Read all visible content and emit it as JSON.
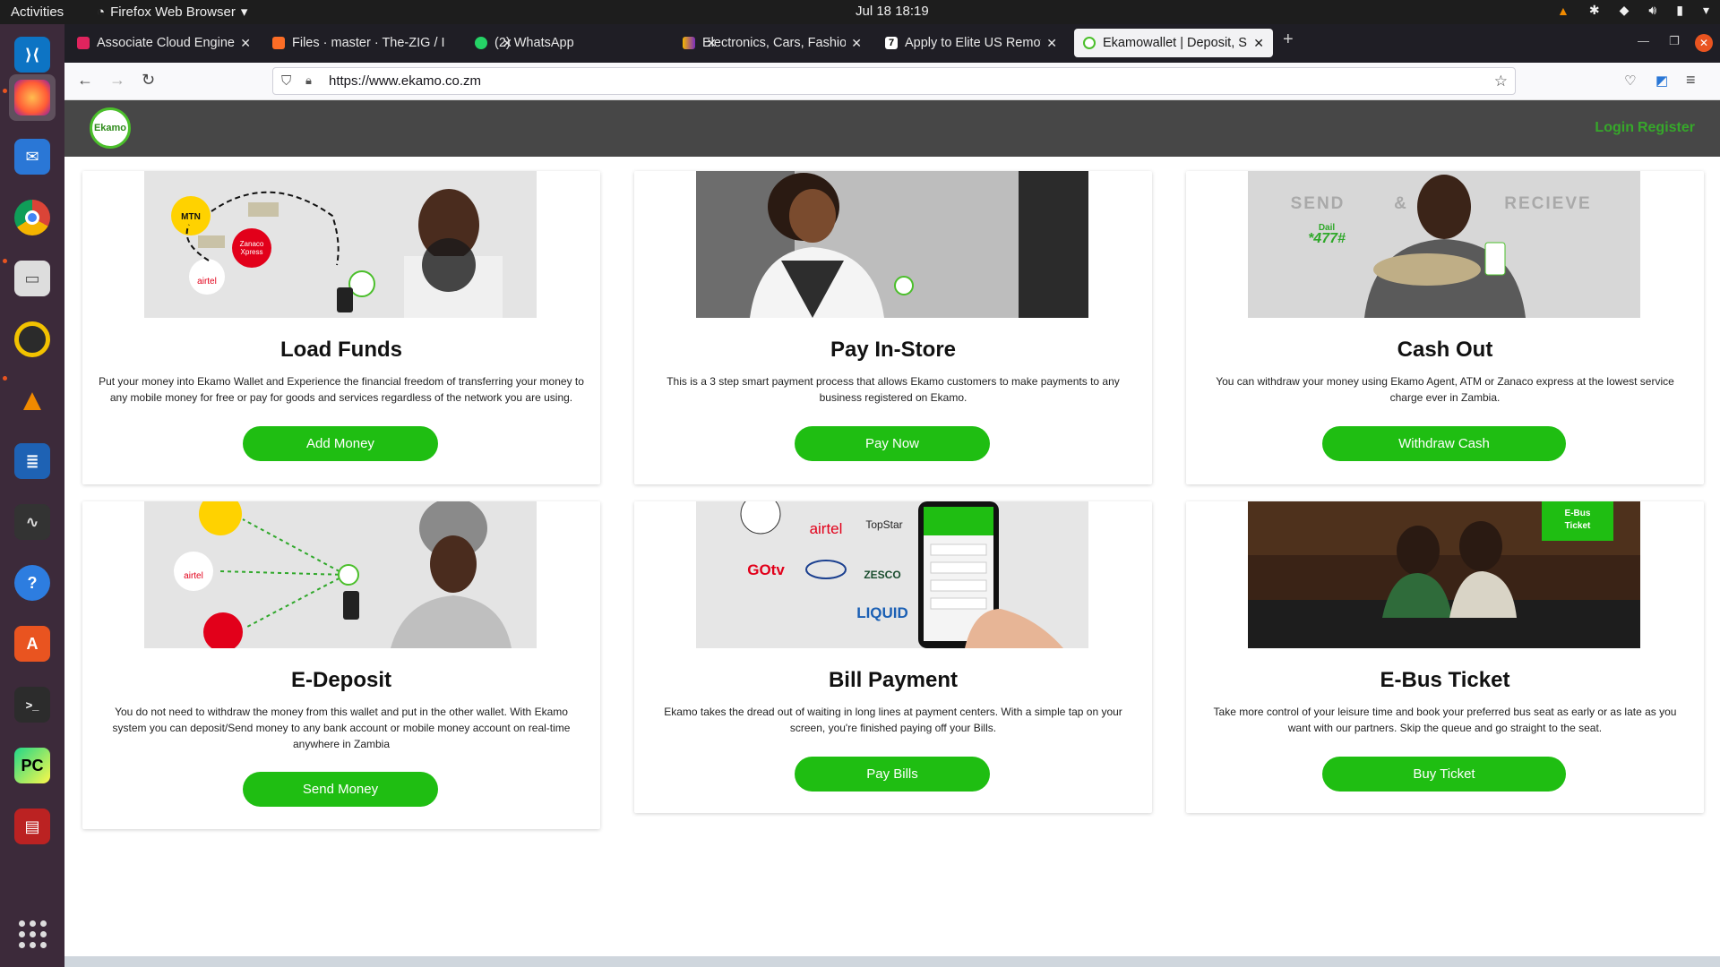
{
  "system": {
    "activities": "Activities",
    "app_menu": "Firefox Web Browser",
    "clock": "Jul 18  18:19"
  },
  "tabs": [
    {
      "title": "Associate Cloud Engineer",
      "color": "#e0245e"
    },
    {
      "title": "Files · master · The-ZIG / I",
      "color": "#fc6d26"
    },
    {
      "title": "(2) WhatsApp",
      "color": "#25d366"
    },
    {
      "title": "Electronics, Cars, Fashion",
      "color": "#f5b700"
    },
    {
      "title": "Apply to Elite US Remote",
      "color": "#222222"
    },
    {
      "title": "Ekamowallet | Deposit, S",
      "color": "#4bbf2b"
    }
  ],
  "url": "https://www.ekamo.co.zm",
  "site": {
    "logo_text": "Ekamo",
    "login": "Login",
    "register": "Register",
    "brand_green": "#1fbe12"
  },
  "cards": [
    {
      "title": "Load Funds",
      "desc": "Put your money into Ekamo Wallet and Experience the financial freedom of transferring your money to any mobile money for free or pay for goods and services regardless of the network you are using.",
      "button": "Add Money"
    },
    {
      "title": "Pay In-Store",
      "desc": "This is a 3 step smart payment process that allows Ekamo customers to make payments to any business registered on Ekamo.",
      "button": "Pay Now"
    },
    {
      "title": "Cash Out",
      "desc": "You can withdraw your money using Ekamo Agent, ATM or Zanaco express at the lowest service charge ever in Zambia.",
      "button": "Withdraw Cash"
    },
    {
      "title": "E-Deposit",
      "desc": "You do not need to withdraw the money from this wallet and put in the other wallet. With Ekamo system you can deposit/Send money to any bank account or mobile money account on real-time anywhere in Zambia",
      "button": "Send Money"
    },
    {
      "title": "Bill Payment",
      "desc": "Ekamo takes the dread out of waiting in long lines at payment centers. With a simple tap on your screen, you're finished paying off your Bills.",
      "button": "Pay Bills"
    },
    {
      "title": "E-Bus Ticket",
      "desc": "Take more control of your leisure time and book your preferred bus seat as early or as late as you want with our partners. Skip the queue and go straight to the seat.",
      "button": "Buy Ticket"
    }
  ],
  "image_text": {
    "mtn": "MTN",
    "airtel": "airtel",
    "zanaco": "Zanaco Xpress",
    "send": "SEND",
    "amp": "&",
    "recieve": "RECIEVE",
    "dail": "Dail",
    "code": "*477#",
    "topstar": "TopStar",
    "gotv": "GOtv",
    "zesco": "ZESCO",
    "liquid": "LIQUID",
    "ebus": "E-Bus Ticket"
  }
}
